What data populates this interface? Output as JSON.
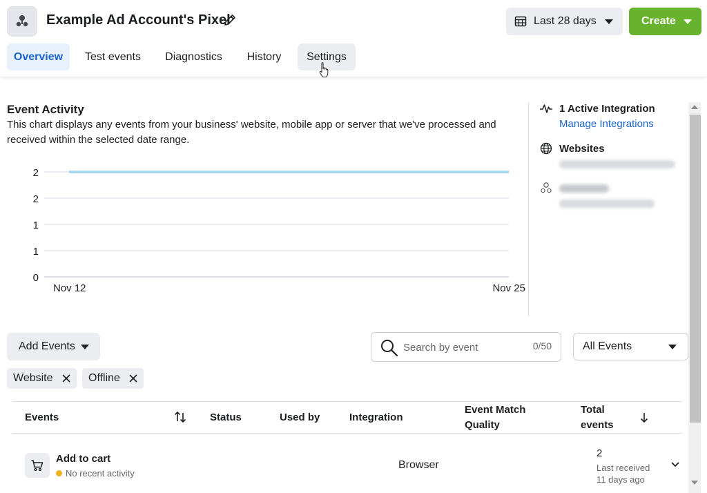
{
  "header": {
    "title": "Example Ad Account's Pixel",
    "date_range": "Last 28 days",
    "create_label": "Create"
  },
  "tabs": [
    {
      "label": "Overview",
      "state": "active"
    },
    {
      "label": "Test events",
      "state": ""
    },
    {
      "label": "Diagnostics",
      "state": ""
    },
    {
      "label": "History",
      "state": ""
    },
    {
      "label": "Settings",
      "state": "hover"
    }
  ],
  "activity": {
    "title": "Event Activity",
    "description": "This chart displays any events from your business' website, mobile app or server that we've processed and received within the selected date range."
  },
  "chart_data": {
    "type": "line",
    "x": [
      "Nov 12",
      "Nov 25"
    ],
    "y_ticks": [
      "0",
      "1",
      "1",
      "2",
      "2"
    ],
    "ylim": [
      0,
      2
    ],
    "series": [
      {
        "values": [
          2,
          2
        ],
        "color": "#9fd6ec"
      }
    ],
    "grid": true
  },
  "sidebar": {
    "integration_title": "1 Active Integration",
    "integration_link": "Manage Integrations",
    "websites_title": "Websites"
  },
  "filters": {
    "add_events": "Add Events",
    "search_placeholder": "Search by event",
    "search_count": "0/50",
    "all_events": "All Events",
    "chips": [
      "Website",
      "Offline"
    ]
  },
  "table": {
    "headers": {
      "events": "Events",
      "status": "Status",
      "used_by": "Used by",
      "integration": "Integration",
      "emq_1": "Event Match",
      "emq_2": "Quality",
      "total_1": "Total",
      "total_2": "events"
    },
    "rows": [
      {
        "name": "Add to cart",
        "status": "No recent activity",
        "integration": "Browser",
        "total": "2",
        "last_received_1": "Last received",
        "last_received_2": "11 days ago"
      }
    ]
  }
}
